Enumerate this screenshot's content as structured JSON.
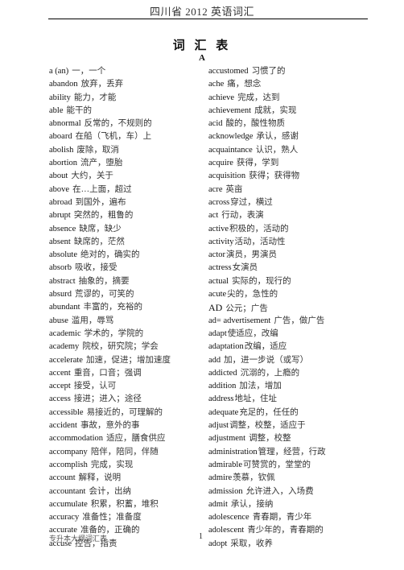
{
  "header": {
    "running_title": "四川省 2012 英语词汇"
  },
  "title": "词 汇 表",
  "section_letter": "A",
  "left_column": [
    {
      "word": "a (an)",
      "def": "一，一个"
    },
    {
      "word": "abandon",
      "def": "放弃，丢弃"
    },
    {
      "word": "ability",
      "def": "能力，才能"
    },
    {
      "word": "able",
      "def": "能干的"
    },
    {
      "word": "abnormal",
      "def": "反常的，不规则的"
    },
    {
      "word": "aboard",
      "def": "在船（飞机，车）上"
    },
    {
      "word": "abolish",
      "def": "废除，取消"
    },
    {
      "word": "abortion",
      "def": "流产，堕胎"
    },
    {
      "word": "about",
      "def": "大约，关于"
    },
    {
      "word": "above",
      "def": "在…上面，超过"
    },
    {
      "word": "abroad",
      "def": "到国外，遍布"
    },
    {
      "word": "abrupt",
      "def": "突然的，粗鲁的"
    },
    {
      "word": "absence",
      "def": "缺席，缺少"
    },
    {
      "word": "absent",
      "def": "缺席的，茫然"
    },
    {
      "word": "absolute",
      "def": "绝对的，确实的"
    },
    {
      "word": "absorb",
      "def": "吸收，接受"
    },
    {
      "word": "abstract",
      "def": "抽象的，摘要"
    },
    {
      "word": "absurd",
      "def": "荒谬的，可笑的"
    },
    {
      "word": "abundant",
      "def": "丰富的，充裕的"
    },
    {
      "word": "abuse",
      "def": "滥用，辱骂"
    },
    {
      "word": "academic",
      "def": "学术的，学院的"
    },
    {
      "word": "academy",
      "def": "院校，研究院；学会"
    },
    {
      "word": "accelerate",
      "def": "加速，促进；增加速度"
    },
    {
      "word": "accent",
      "def": "重音，口音；强调"
    },
    {
      "word": "accept",
      "def": "接受，认可"
    },
    {
      "word": "access",
      "def": "接进；进入；途径"
    },
    {
      "word": "accessible",
      "def": "易接近的，可理解的"
    },
    {
      "word": "accident",
      "def": "事故，意外的事"
    },
    {
      "word": "accommodation",
      "def": "适应，膳食供应"
    },
    {
      "word": "accompany",
      "def": "陪伴，陪同，伴随"
    },
    {
      "word": "accomplish",
      "def": "完成，实现"
    },
    {
      "word": "account",
      "def": "解释，说明"
    },
    {
      "word": "accountant",
      "def": "会计，出纳"
    },
    {
      "word": "accumulate",
      "def": "积累，积蓄，堆积"
    },
    {
      "word": "accuracy",
      "def": "准备性；准备度"
    },
    {
      "word": "accurate",
      "def": "准备的，正确的"
    },
    {
      "word": "accuse",
      "def": "控告，指责"
    }
  ],
  "right_column": [
    {
      "word": "accustomed",
      "def": "习惯了的"
    },
    {
      "word": "ache",
      "def": "痛，想念"
    },
    {
      "word": "achieve",
      "def": "完成，达到"
    },
    {
      "word": "achievement",
      "def": "成就，实现"
    },
    {
      "word": "acid",
      "def": "酸的，酸性物质"
    },
    {
      "word": "acknowledge",
      "def": "承认，感谢"
    },
    {
      "word": "acquaintance",
      "def": "认识，熟人"
    },
    {
      "word": "acquire",
      "def": "获得，学到"
    },
    {
      "word": "acquisition",
      "def": "获得；获得物"
    },
    {
      "word": "acre",
      "def": "英亩"
    },
    {
      "word": "across",
      "def": "穿过，横过",
      "tight": true
    },
    {
      "word": "act",
      "def": "行动，表演"
    },
    {
      "word": "active",
      "def": "积极的，活动的",
      "tight": true
    },
    {
      "word": "activity",
      "def": "活动，活动性",
      "tight": true
    },
    {
      "word": "actor",
      "def": "演员，男演员",
      "tight": true
    },
    {
      "word": "actress",
      "def": "女演员",
      "tight": true
    },
    {
      "word": "actual",
      "def": "实际的，现行的"
    },
    {
      "word": "acute",
      "def": "尖的，急性的",
      "tight": true
    },
    {
      "word": "AD",
      "def": "公元；广告",
      "caps": true
    },
    {
      "word": "ad= advertisement",
      "def": "广告，做广告"
    },
    {
      "word": "adapt",
      "def": "使适应，改编",
      "tight": true
    },
    {
      "word": "adaptation",
      "def": "改编，适应",
      "tight": true
    },
    {
      "word": "add",
      "def": "加，进一步说（或写）"
    },
    {
      "word": "addicted",
      "def": "沉溺的，上瘾的"
    },
    {
      "word": "addition",
      "def": "加法，增加"
    },
    {
      "word": "address",
      "def": "地址，住址",
      "tight": true
    },
    {
      "word": "adequate",
      "def": "充足的，任任的",
      "tight": true
    },
    {
      "word": "adjust",
      "def": "调整，校整，适应于",
      "tight": true
    },
    {
      "word": "adjustment",
      "def": "调整，校整"
    },
    {
      "word": "administration",
      "def": "管理，经营，行政",
      "tight": true
    },
    {
      "word": "admirable",
      "def": "可赞赏的，堂堂的",
      "tight": true
    },
    {
      "word": "admire",
      "def": "羡慕，钦佩",
      "tight": true
    },
    {
      "word": "admission",
      "def": "允许进入，入场费"
    },
    {
      "word": "admit",
      "def": "承认，接纳"
    },
    {
      "word": "adolescence",
      "def": "青春期，青少年"
    },
    {
      "word": "adolescent",
      "def": "青少年的，青春期的"
    },
    {
      "word": "adopt",
      "def": "采取，收养"
    }
  ],
  "footer": {
    "left_text": "专升本大纲词汇表",
    "page_number": "1"
  }
}
